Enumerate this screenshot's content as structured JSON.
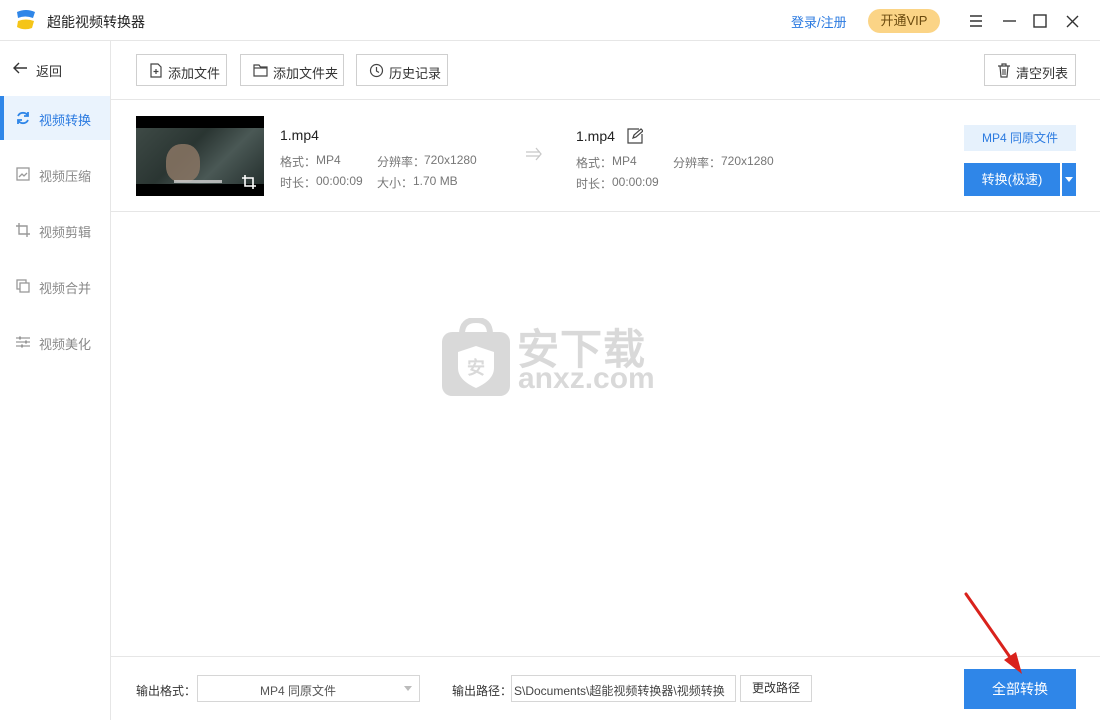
{
  "app": {
    "title": "超能视频转换器",
    "login_label": "登录/注册",
    "vip_label": "开通VIP"
  },
  "window_controls": [
    "menu-icon",
    "minimize-icon",
    "maximize-icon",
    "close-icon"
  ],
  "sidebar": {
    "back_label": "返回",
    "items": [
      {
        "label": "视频转换",
        "icon": "refresh-icon",
        "active": true
      },
      {
        "label": "视频压缩",
        "icon": "compress-icon",
        "active": false
      },
      {
        "label": "视频剪辑",
        "icon": "crop-icon",
        "active": false
      },
      {
        "label": "视频合并",
        "icon": "merge-icon",
        "active": false
      },
      {
        "label": "视频美化",
        "icon": "sliders-icon",
        "active": false
      }
    ]
  },
  "toolbar": {
    "add_file": "添加文件",
    "add_folder": "添加文件夹",
    "history": "历史记录",
    "clear_list": "清空列表"
  },
  "file": {
    "source": {
      "name": "1.mp4",
      "format_label": "格式：",
      "format": "MP4",
      "resolution_label": "分辨率：",
      "resolution": "720x1280",
      "duration_label": "时长：",
      "duration": "00:00:09",
      "size_label": "大小：",
      "size": "1.70 MB"
    },
    "target": {
      "name": "1.mp4",
      "format_label": "格式：",
      "format": "MP4",
      "resolution_label": "分辨率：",
      "resolution": "720x1280",
      "duration_label": "时长：",
      "duration": "00:00:09"
    },
    "output_format_badge": "MP4 同原文件",
    "convert_label": "转换(极速)"
  },
  "watermark": {
    "cn": "安下载",
    "en": "anxz.com"
  },
  "bottom": {
    "output_format_label": "输出格式：",
    "output_format_value": "MP4 同原文件",
    "output_path_label": "输出路径：",
    "output_path_value": "S\\Documents\\超能视频转换器\\视频转换",
    "change_path_label": "更改路径",
    "convert_all_label": "全部转换"
  },
  "colors": {
    "accent": "#2f86e8",
    "vip": "#fbd486",
    "annotation_arrow": "#d9221c"
  }
}
